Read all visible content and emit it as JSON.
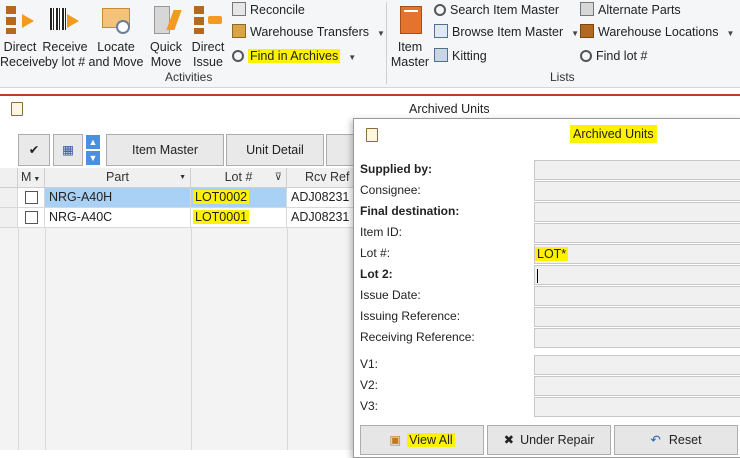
{
  "ribbon": {
    "activities": {
      "label": "Activities",
      "buttons": [
        {
          "label1": "Direct",
          "label2": "Receive"
        },
        {
          "label1": "Receive",
          "label2": "by lot #"
        },
        {
          "label1": "Locate",
          "label2": "and Move"
        },
        {
          "label1": "Quick",
          "label2": "Move"
        },
        {
          "label1": "Direct",
          "label2": "Issue"
        }
      ],
      "small": [
        "Reconcile",
        "Warehouse Transfers",
        "Find in Archives"
      ]
    },
    "lists": {
      "label": "Lists",
      "item_master": {
        "label1": "Item",
        "label2": "Master"
      },
      "small_col1": [
        "Search Item Master",
        "Browse Item Master",
        "Kitting"
      ],
      "small_col2": [
        "Alternate Parts",
        "Warehouse Locations",
        "Find lot #"
      ]
    }
  },
  "window": {
    "title": "Archived Units",
    "toolbar": {
      "item_master": "Item Master",
      "unit_detail": "Unit Detail"
    }
  },
  "grid": {
    "columns": [
      "M",
      "Part",
      "Lot #",
      "Rcv Ref"
    ],
    "rows": [
      {
        "part": "NRG-A40H",
        "lot": "LOT0002",
        "rcv": "ADJ08231"
      },
      {
        "part": "NRG-A40C",
        "lot": "LOT0001",
        "rcv": "ADJ08231"
      }
    ]
  },
  "dialog": {
    "title": "Archived Units",
    "fields": [
      {
        "label": "Supplied by:",
        "bold": true,
        "value": ""
      },
      {
        "label": "Consignee:",
        "bold": false,
        "value": ""
      },
      {
        "label": "Final destination:",
        "bold": true,
        "value": ""
      },
      {
        "label": "Item ID:",
        "bold": false,
        "value": ""
      },
      {
        "label": "Lot #:",
        "bold": false,
        "value": "LOT*"
      },
      {
        "label": "Lot 2:",
        "bold": true,
        "value": ""
      },
      {
        "label": "Issue Date:",
        "bold": false,
        "value": ""
      },
      {
        "label": "Issuing Reference:",
        "bold": false,
        "value": ""
      },
      {
        "label": "Receiving Reference:",
        "bold": false,
        "value": ""
      },
      {
        "label": "V1:",
        "bold": false,
        "value": ""
      },
      {
        "label": "V2:",
        "bold": false,
        "value": ""
      },
      {
        "label": "V3:",
        "bold": false,
        "value": ""
      }
    ],
    "buttons": {
      "view_all": "View All",
      "under_repair": "Under Repair",
      "reset": "Reset"
    }
  },
  "colors": {
    "highlight": "#fff200",
    "selected_row": "#a9d1f5",
    "accent": "#c0392b"
  }
}
